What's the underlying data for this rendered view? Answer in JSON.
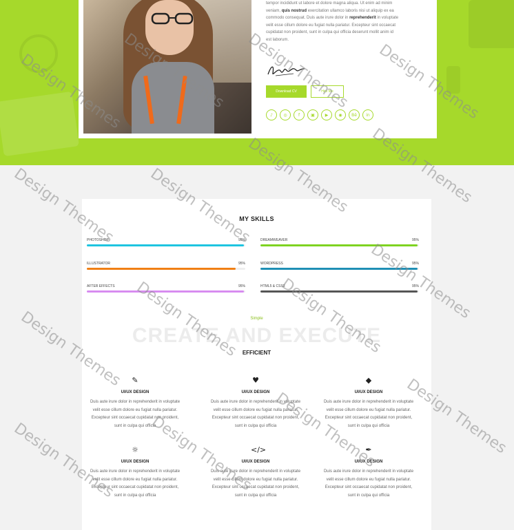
{
  "hero": {
    "bio_lines": [
      [
        "tempor incididunt ut labore et dolore magna aliqua. Ut enim ad minim",
        ""
      ],
      [
        "veniam, ",
        "quis nostrud",
        " exercitation ullamco laboris nisi ut aliquip ex ea"
      ],
      [
        "commodo consequat. Duis aute irure dolor in ",
        "reprehenderit",
        " in voluptate"
      ],
      [
        "velit esse cillum dolore eu fugiat nulla pariatur. Excepteur sint occaecat",
        ""
      ],
      [
        "cupidatat non proident, sunt in culpa qui officia deserunt mollit anim id",
        ""
      ],
      [
        "est laborum.",
        ""
      ]
    ],
    "btn_cv": "Download CV",
    "btn_hire": "Hire Me",
    "socials": [
      {
        "icon": "music-icon",
        "glyph": "♪"
      },
      {
        "icon": "dribbble-icon",
        "glyph": "◎"
      },
      {
        "icon": "facebook-icon",
        "glyph": "f"
      },
      {
        "icon": "flickr-icon",
        "glyph": "▣"
      },
      {
        "icon": "youtube-icon",
        "glyph": "▶"
      },
      {
        "icon": "instagram-icon",
        "glyph": "◉"
      },
      {
        "icon": "behance-icon",
        "glyph": "Bē"
      },
      {
        "icon": "linkedin-icon",
        "glyph": "in"
      }
    ]
  },
  "skills": {
    "title": "MY SKILLS",
    "items": [
      {
        "label": "PHOTOSHOP",
        "pct_text": "95%",
        "value": 0.99,
        "color": "#1ec4e0"
      },
      {
        "label": "DREAMWEAVER",
        "pct_text": "95%",
        "value": 0.99,
        "color": "#7ed321"
      },
      {
        "label": "ILLUSTRATOR",
        "pct_text": "95%",
        "value": 0.94,
        "color": "#f07f14"
      },
      {
        "label": "WORDPRESS",
        "pct_text": "95%",
        "value": 0.99,
        "color": "#1f8fb5"
      },
      {
        "label": "AFTER EFFECTS",
        "pct_text": "95%",
        "value": 0.99,
        "color": "#d78cf0"
      },
      {
        "label": "HTML5 & CSS3",
        "pct_text": "95%",
        "value": 0.99,
        "color": "#555555"
      }
    ]
  },
  "section": {
    "tagline": "Simple",
    "big": "CREATE AND EXECUTE",
    "subtitle": "EFFICIENT"
  },
  "features": [
    {
      "icon": "pencil-icon",
      "glyph": "✎",
      "title": "UI/UX DESIGN",
      "lines": [
        "Duis aute irure dolor in reprehenderit in voluptate",
        "velit esse cillum dolore eu fugiat nulla pariatur.",
        "Excepteur sint occaecat cupidatat non proident,",
        "sunt in culpa qui officia"
      ]
    },
    {
      "icon": "heart-icon",
      "glyph": "♥",
      "title": "UI/UX DESIGN",
      "lines": [
        "Duis aute irure dolor in reprehenderit in voluptate",
        "velit esse cillum dolore eu fugiat nulla pariatur.",
        "Excepteur sint occaecat cupidatat non proident,",
        "sunt in culpa qui officia"
      ]
    },
    {
      "icon": "tags-icon",
      "glyph": "◆",
      "title": "UI/UX DESIGN",
      "lines": [
        "Duis aute irure dolor in reprehenderit in voluptate",
        "velit esse cillum dolore eu fugiat nulla pariatur.",
        "Excepteur sint occaecat cupidatat non proident,",
        "sunt in culpa qui officia"
      ]
    },
    {
      "icon": "lightbulb-icon",
      "glyph": "☼",
      "title": "UI/UX DESIGN",
      "lines": [
        "Duis aute irure dolor in reprehenderit in voluptate",
        "velit esse cillum dolore eu fugiat nulla pariatur.",
        "Excepteur sint occaecat cupidatat non proident,",
        "sunt in culpa qui officia"
      ]
    },
    {
      "icon": "code-icon",
      "glyph": "</>",
      "title": "UI/UX DESIGN",
      "lines": [
        "Duis aute irure dolor in reprehenderit in voluptate",
        "velit esse cillum dolore eu fugiat nulla pariatur.",
        "Excepteur sint occaecat cupidatat non proident,",
        "sunt in culpa qui officia"
      ]
    },
    {
      "icon": "eyedropper-icon",
      "glyph": "✒",
      "title": "UI/UX DESIGN",
      "lines": [
        "Duis aute irure dolor in reprehenderit in voluptate",
        "velit esse cillum dolore eu fugiat nulla pariatur.",
        "Excepteur sint occaecat cupidatat non proident,",
        "sunt in culpa qui officia"
      ]
    }
  ],
  "watermark": "Design Themes"
}
